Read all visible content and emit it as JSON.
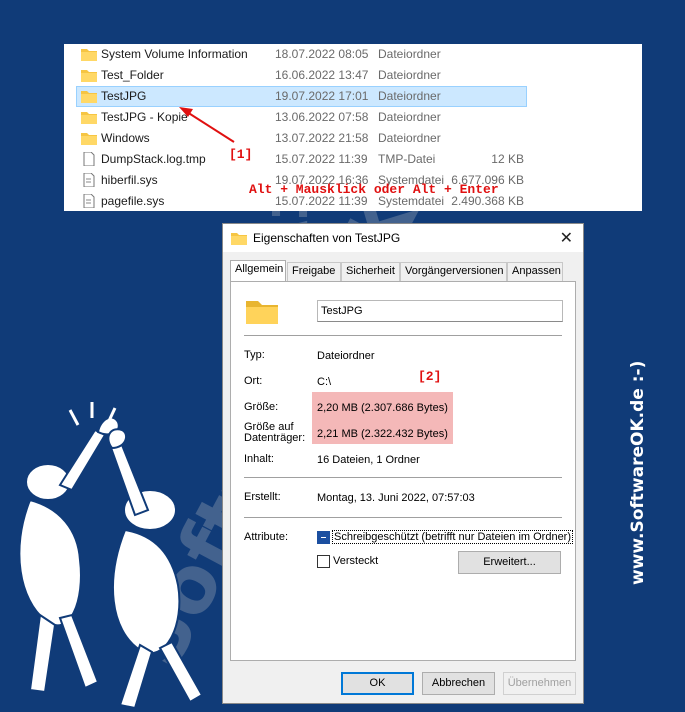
{
  "explorer": {
    "rows": [
      {
        "name": "System Volume Information",
        "date": "18.07.2022 08:05",
        "type": "Dateiordner",
        "size": "",
        "kind": "folder"
      },
      {
        "name": "Test_Folder",
        "date": "16.06.2022 13:47",
        "type": "Dateiordner",
        "size": "",
        "kind": "folder"
      },
      {
        "name": "TestJPG",
        "date": "19.07.2022 17:01",
        "type": "Dateiordner",
        "size": "",
        "kind": "folder"
      },
      {
        "name": "TestJPG - Kopie",
        "date": "13.06.2022 07:58",
        "type": "Dateiordner",
        "size": "",
        "kind": "folder"
      },
      {
        "name": "Windows",
        "date": "13.07.2022 21:58",
        "type": "Dateiordner",
        "size": "",
        "kind": "folder"
      },
      {
        "name": "DumpStack.log.tmp",
        "date": "15.07.2022 11:39",
        "type": "TMP-Datei",
        "size": "12 KB",
        "kind": "file"
      },
      {
        "name": "hiberfil.sys",
        "date": "19.07.2022 16:36",
        "type": "Systemdatei",
        "size": "6.677.096 KB",
        "kind": "sysfile"
      },
      {
        "name": "pagefile.sys",
        "date": "15.07.2022 11:39",
        "type": "Systemdatei",
        "size": "2.490.368 KB",
        "kind": "sysfile"
      }
    ],
    "annotation_label": "[1]",
    "hint": "Alt + Mausklick oder Alt + Enter"
  },
  "dialog": {
    "title": "Eigenschaften von TestJPG",
    "close_glyph": "✕",
    "tabs": [
      "Allgemein",
      "Freigabe",
      "Sicherheit",
      "Vorgängerversionen",
      "Anpassen"
    ],
    "folder_name": "TestJPG",
    "annotation_label": "[2]",
    "fields": {
      "typ_label": "Typ:",
      "typ_value": "Dateiordner",
      "ort_label": "Ort:",
      "ort_value": "C:\\",
      "groesse_label": "Größe:",
      "groesse_value": "2,20 MB (2.307.686 Bytes)",
      "groesse_dt_label_1": "Größe auf",
      "groesse_dt_label_2": "Datenträger:",
      "groesse_dt_value": "2,21 MB (2.322.432 Bytes)",
      "inhalt_label": "Inhalt:",
      "inhalt_value": "16 Dateien, 1 Ordner",
      "erstellt_label": "Erstellt:",
      "erstellt_value": "Montag, 13. Juni 2022, 07:57:03",
      "attribute_label": "Attribute:"
    },
    "readonly_label": "Schreibgeschützt (betrifft nur Dateien im Ordner)",
    "hidden_label": "Versteckt",
    "advanced_button": "Erweitert...",
    "ok_button": "OK",
    "cancel_button": "Abbrechen",
    "apply_button": "Übernehmen"
  },
  "branding": {
    "side_text": "www.SoftwareOK.de :-)",
    "watermark": "SoftwareOK.de"
  },
  "colors": {
    "background": "#103b78",
    "accent_red": "#e01010",
    "selection": "#cce8ff",
    "highlight": "#f4b8b8"
  }
}
